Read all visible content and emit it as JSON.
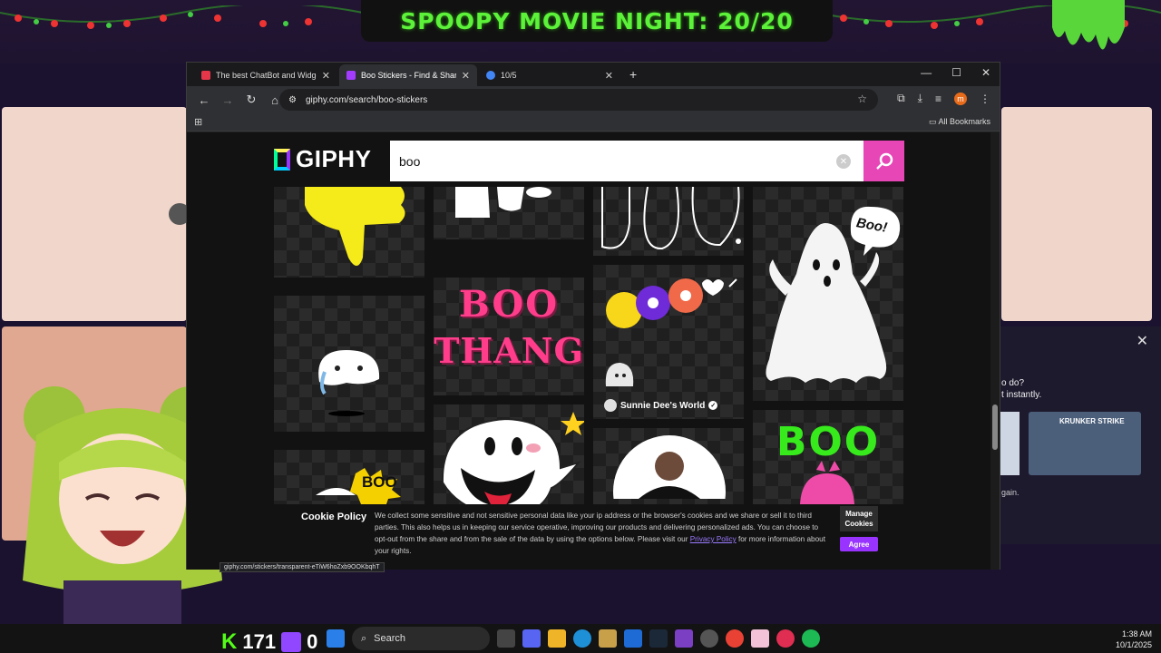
{
  "overlay": {
    "banner_text": "SPOOPY MOVIE NIGHT: 20/20",
    "kick_count": "171",
    "twitch_count": "0",
    "side_panel_line1": "o do?",
    "side_panel_line2": "t instantly.",
    "side_panel_line3": "gain.",
    "krunker_label": "KRUNKER STRIKE"
  },
  "browser": {
    "tabs": [
      {
        "label": "The best ChatBot and Widgets",
        "close": "✕",
        "favicon_color": "#e5364a"
      },
      {
        "label": "Boo Stickers - Find & Share on",
        "close": "✕",
        "favicon_color": "#a33cff"
      },
      {
        "label": "10/5",
        "close": "✕",
        "favicon_color": "#4285f4"
      }
    ],
    "new_tab": "+",
    "address": "giphy.com/search/boo-stickers",
    "bookmarks_label": "All Bookmarks",
    "profile_initial": "m",
    "status_url": "giphy.com/stickers/transparent-eTiW6hoZxb9OOKbqhT"
  },
  "giphy": {
    "logo_text": "GIPHY",
    "search_value": "boo",
    "stickers": {
      "boo_thang_line1": "BOO",
      "boo_thang_line2": "THANG",
      "boo_bubble": "Boo!",
      "boo_green": "BOO",
      "boo_badge": "BOO",
      "creator_name": "Sunnie Dee's World"
    },
    "cookie": {
      "title": "Cookie Policy",
      "body_pre": "We collect some sensitive and not sensitive personal data like your ip address or the browser's cookies and we share or sell it to third parties. This also helps us in keeping our service operative, improving our products and delivering personalized ads. You can choose to opt-out from the share and from the sale of the data by using the options below. Please visit our ",
      "privacy_link": "Privacy Policy",
      "body_post": " for more information about your rights.",
      "manage_label": "Manage Cookies",
      "agree_label": "Agree"
    }
  },
  "taskbar": {
    "search_label": "Search",
    "time": "1:38 AM",
    "date": "10/1/2025"
  }
}
